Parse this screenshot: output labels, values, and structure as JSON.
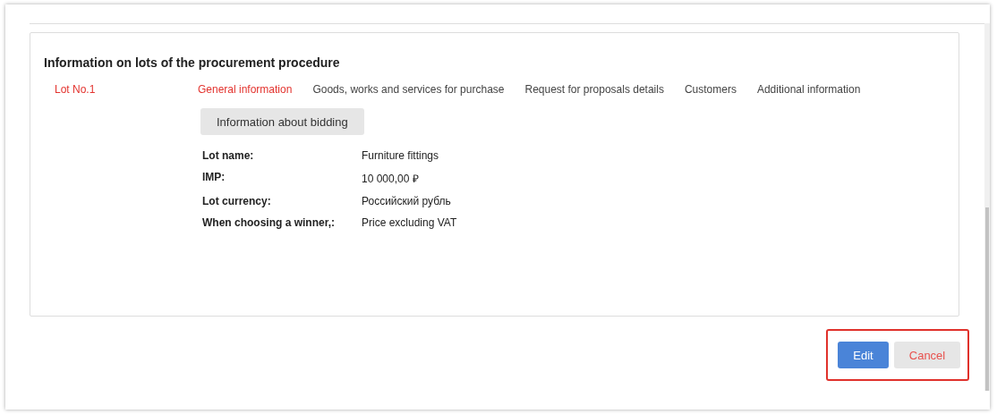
{
  "panel": {
    "title": "Information on lots of the procurement procedure",
    "lots": [
      {
        "label": "Lot No.1",
        "selected": true
      }
    ],
    "sections": [
      {
        "label": "General information",
        "selected": true
      },
      {
        "label": "Goods, works and services for purchase",
        "selected": false
      },
      {
        "label": "Request for proposals details",
        "selected": false
      },
      {
        "label": "Customers",
        "selected": false
      },
      {
        "label": "Additional information",
        "selected": false
      }
    ],
    "sub_button": "Information about bidding",
    "fields": [
      {
        "label": "Lot name:",
        "value": "Furniture fittings"
      },
      {
        "label": "IMP:",
        "value": "10 000,00 ₽"
      },
      {
        "label": "Lot currency:",
        "value": "Российский рубль"
      },
      {
        "label": "When choosing a winner,:",
        "value": "Price excluding VAT"
      }
    ]
  },
  "buttons": [
    {
      "label": "Edit",
      "kind": "primary"
    },
    {
      "label": "Cancel",
      "kind": "secondary"
    }
  ]
}
